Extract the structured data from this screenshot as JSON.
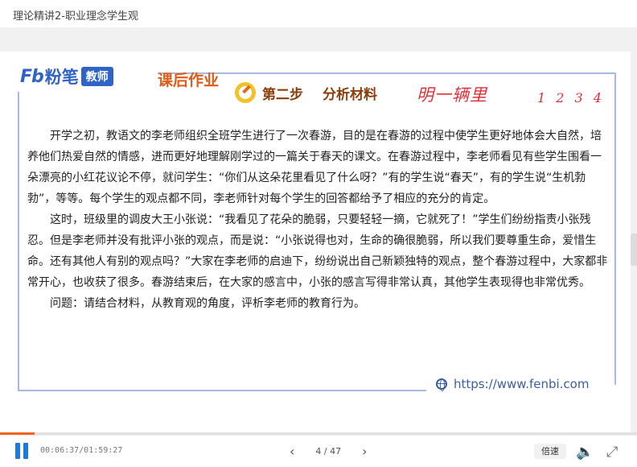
{
  "window": {
    "title": "理论精讲2-职业理念学生观"
  },
  "slide": {
    "logo": {
      "mark": "Fb",
      "brand": "粉笔",
      "badge": "教师"
    },
    "homework_title": "课后作业",
    "step_label": "第二步",
    "step_title": "分析材料",
    "handwriting_main": "明一辆里",
    "handwriting_numbers": "1 2 3 4",
    "paragraphs": [
      "开学之初，教语文的李老师组织全班学生进行了一次春游，目的是在春游的过程中使学生更好地体会大自然，培养他们热爱自然的情感，进而更好地理解刚学过的一篇关于春天的课文。在春游过程中，李老师看见有些学生围看一朵漂亮的小红花议论不停，就问学生：“你们从这朵花里看见了什么呀？”有的学生说“春天”，有的学生说“生机勃勃”，等等。每个学生的观点都不同，李老师针对每个学生的回答都给予了相应的充分的肯定。",
      "这时，班级里的调皮大王小张说：“我看见了花朵的脆弱，只要轻轻一摘，它就死了！”学生们纷纷指责小张残忍。但是李老师并没有批评小张的观点，而是说：“小张说得也对，生命的确很脆弱，所以我们要尊重生命，爱惜生命。还有其他人有别的观点吗？”大家在李老师的启迪下，纷纷说出自己新颖独特的观点，整个春游过程中，大家都非常开心，也收获了很多。春游结束后，在大家的感言中，小张的感言写得非常认真，其他学生表现得也非常优秀。",
      "问题：请结合材料，从教育观的角度，评析李老师的教育行为。"
    ],
    "url": "https://www.fenbi.com"
  },
  "player": {
    "progress": 0.054,
    "time_display": "00:06:37/01:59:27",
    "prev_label": "‹",
    "page_display": "4 / 47",
    "next_label": "›",
    "speed_label": "倍速",
    "volume_icon": "volume-icon",
    "fullscreen_icon": "fullscreen-icon",
    "accent_color": "#f4631d",
    "play_color": "#1d78e0"
  }
}
